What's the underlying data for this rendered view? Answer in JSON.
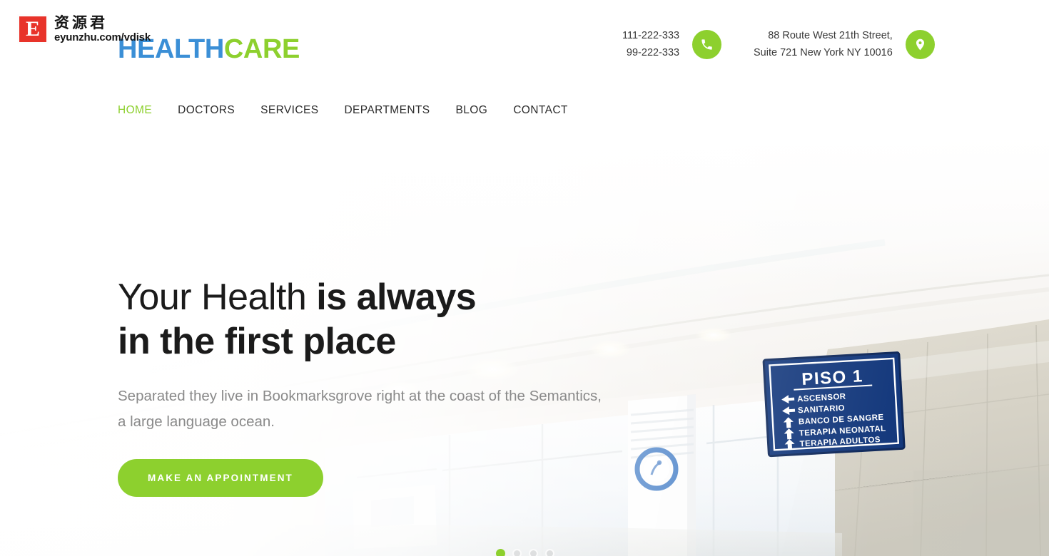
{
  "brand": {
    "logo_primary": "HEALTH",
    "logo_secondary": "CARE",
    "color_blue": "#3b8fd6",
    "color_green": "#8dd02e"
  },
  "header": {
    "phone": {
      "icon": "phone-icon",
      "line1": "111-222-333",
      "line2": "99-222-333"
    },
    "address": {
      "icon": "map-pin-icon",
      "line1": "88 Route West 21th Street,",
      "line2": "Suite 721 New York NY 10016"
    }
  },
  "nav": {
    "items": [
      {
        "label": "HOME",
        "active": true
      },
      {
        "label": "DOCTORS",
        "active": false
      },
      {
        "label": "SERVICES",
        "active": false
      },
      {
        "label": "DEPARTMENTS",
        "active": false
      },
      {
        "label": "BLOG",
        "active": false
      },
      {
        "label": "CONTACT",
        "active": false
      }
    ]
  },
  "hero": {
    "title_light": "Your Health ",
    "title_bold_line1": "is always",
    "title_line2": "in the first place",
    "subtitle": "Separated they live in Bookmarksgrove right at the coast of the Semantics, a large language ocean.",
    "cta_label": "MAKE AN APPOINTMENT",
    "slider": {
      "total_dots": 4,
      "active_index": 1
    },
    "photo_sign": {
      "title": "PISO 1",
      "rows": [
        {
          "arrow": "left",
          "label": "ASCENSOR"
        },
        {
          "arrow": "left",
          "label": "SANITARIO"
        },
        {
          "arrow": "up",
          "label": "BANCO DE SANGRE"
        },
        {
          "arrow": "up",
          "label": "TERAPIA NEONATAL"
        },
        {
          "arrow": "up",
          "label": "TERAPIA ADULTOS"
        }
      ]
    }
  },
  "watermark": {
    "badge_letter": "E",
    "chinese": "资源君",
    "url": "eyunzhu.com/vdisk"
  }
}
